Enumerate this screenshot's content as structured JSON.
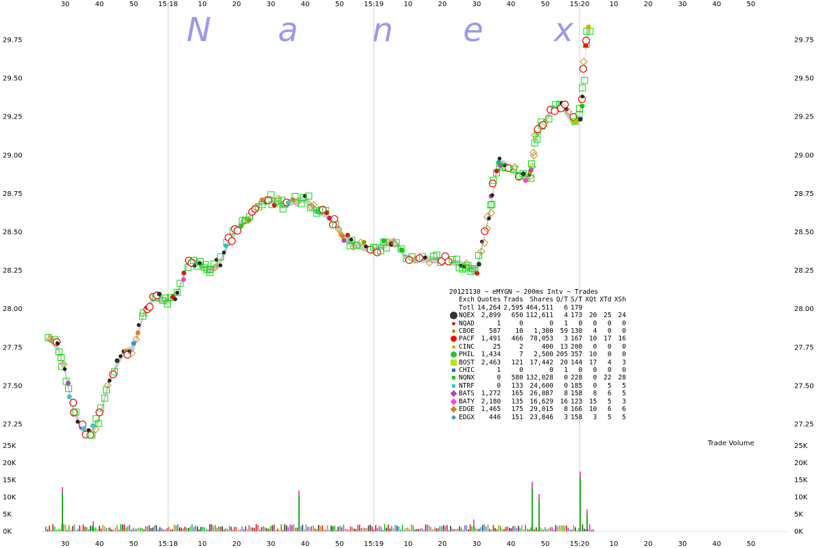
{
  "watermark": [
    "N",
    "a",
    "n",
    "e",
    "x"
  ],
  "legend_title": "20121130 ~ eMYGN ~ 200ms Intv ~ Trades",
  "legend_header": [
    "Exch",
    "Quotes",
    "Trads",
    "Shares",
    "Q/T",
    "S/T",
    "XQt",
    "XTd",
    "XSh"
  ],
  "legend_total": [
    "Totl",
    "14,264",
    "2,595",
    "464,511",
    "6",
    "179",
    "",
    "",
    ""
  ],
  "legend_rows": [
    {
      "exch": "NQEX",
      "quotes": "2,899",
      "trads": "650",
      "shares": "112,611",
      "qt": "4",
      "st": "173",
      "xqt": "20",
      "xtd": "25",
      "xsh": "24",
      "color": "#333333",
      "marker": "circle-large"
    },
    {
      "exch": "NQAD",
      "quotes": "1",
      "trads": "0",
      "shares": "0",
      "qt": "1",
      "st": "0",
      "xqt": "0",
      "xtd": "0",
      "xsh": "0",
      "color": "#cc2222",
      "marker": "circle-small"
    },
    {
      "exch": "CBOE",
      "quotes": "587",
      "trads": "10",
      "shares": "1,300",
      "qt": "59",
      "st": "130",
      "xqt": "4",
      "xtd": "0",
      "xsh": "0",
      "color": "#999900",
      "marker": "circle-small"
    },
    {
      "exch": "PACF",
      "quotes": "1,491",
      "trads": "466",
      "shares": "78,053",
      "qt": "3",
      "st": "167",
      "xqt": "10",
      "xtd": "17",
      "xsh": "16",
      "color": "#ff0000",
      "marker": "circle-medium"
    },
    {
      "exch": "CINC",
      "quotes": "25",
      "trads": "2",
      "shares": "400",
      "qt": "13",
      "st": "200",
      "xqt": "0",
      "xtd": "0",
      "xsh": "0",
      "color": "#ddaa00",
      "marker": "circle-small"
    },
    {
      "exch": "PHIL",
      "quotes": "1,434",
      "trads": "7",
      "shares": "2,500",
      "qt": "205",
      "st": "357",
      "xqt": "10",
      "xtd": "0",
      "xsh": "0",
      "color": "#33bb33",
      "marker": "circle-medium"
    },
    {
      "exch": "BOST",
      "quotes": "2,463",
      "trads": "121",
      "shares": "17,442",
      "qt": "20",
      "st": "144",
      "xqt": "17",
      "xtd": "4",
      "xsh": "3",
      "color": "#aaee00",
      "marker": "square-large"
    },
    {
      "exch": "CHIC",
      "quotes": "1",
      "trads": "0",
      "shares": "0",
      "qt": "1",
      "st": "0",
      "xqt": "0",
      "xtd": "0",
      "xsh": "0",
      "color": "#3366cc",
      "marker": "square-small"
    },
    {
      "exch": "NQNX",
      "quotes": "0",
      "trads": "580",
      "shares": "132,028",
      "qt": "0",
      "st": "228",
      "xqt": "0",
      "xtd": "22",
      "xsh": "28",
      "color": "#00cc00",
      "marker": "square-small"
    },
    {
      "exch": "NTRF",
      "quotes": "0",
      "trads": "133",
      "shares": "24,600",
      "qt": "0",
      "st": "185",
      "xqt": "0",
      "xtd": "5",
      "xsh": "5",
      "color": "#33cccc",
      "marker": "square-small"
    },
    {
      "exch": "BATS",
      "quotes": "1,272",
      "trads": "165",
      "shares": "26,087",
      "qt": "8",
      "st": "158",
      "xqt": "8",
      "xtd": "6",
      "xsh": "5",
      "color": "#aa44cc",
      "marker": "diamond"
    },
    {
      "exch": "BATY",
      "quotes": "2,180",
      "trads": "135",
      "shares": "16,629",
      "qt": "16",
      "st": "123",
      "xqt": "15",
      "xtd": "5",
      "xsh": "3",
      "color": "#ff44cc",
      "marker": "diamond"
    },
    {
      "exch": "EDGE",
      "quotes": "1,465",
      "trads": "175",
      "shares": "29,015",
      "qt": "8",
      "st": "166",
      "xqt": "10",
      "xtd": "6",
      "xsh": "6",
      "color": "#cc8822",
      "marker": "diamond"
    },
    {
      "exch": "EDGX",
      "quotes": "446",
      "trads": "151",
      "shares": "23,846",
      "qt": "3",
      "st": "158",
      "xqt": "3",
      "xtd": "5",
      "xsh": "5",
      "color": "#3399cc",
      "marker": "diamond-small"
    }
  ],
  "chart_data": {
    "type": "scatter",
    "title": "",
    "x_tick_labels": [
      "30",
      "40",
      "50",
      "15:18",
      "10",
      "20",
      "30",
      "40",
      "50",
      "15:19",
      "10",
      "20",
      "30",
      "40",
      "50",
      "15:20",
      "10",
      "20",
      "30",
      "40",
      "50"
    ],
    "x_range": [
      "15:17:25",
      "15:20:55"
    ],
    "y_price_ticks": [
      27.25,
      27.5,
      27.75,
      28.0,
      28.25,
      28.5,
      28.75,
      29.0,
      29.25,
      29.5,
      29.75
    ],
    "y_price_range": [
      27.13,
      29.89
    ],
    "volume_axis": {
      "title": "Trade Volume",
      "ticks": [
        "0K",
        "5K",
        "10K",
        "15K",
        "20K",
        "25K"
      ],
      "max": 25000
    },
    "price_path": [
      [
        "15:17:25",
        27.82
      ],
      [
        "15:17:28",
        27.75
      ],
      [
        "15:17:30",
        27.6
      ],
      [
        "15:17:32",
        27.38
      ],
      [
        "15:17:35",
        27.22
      ],
      [
        "15:17:38",
        27.2
      ],
      [
        "15:17:40",
        27.3
      ],
      [
        "15:17:43",
        27.55
      ],
      [
        "15:17:47",
        27.72
      ],
      [
        "15:17:50",
        27.75
      ],
      [
        "15:17:53",
        27.98
      ],
      [
        "15:17:56",
        28.08
      ],
      [
        "15:18:00",
        28.05
      ],
      [
        "15:18:03",
        28.12
      ],
      [
        "15:18:06",
        28.32
      ],
      [
        "15:18:09",
        28.3
      ],
      [
        "15:18:12",
        28.25
      ],
      [
        "15:18:15",
        28.3
      ],
      [
        "15:18:18",
        28.45
      ],
      [
        "15:18:21",
        28.55
      ],
      [
        "15:18:24",
        28.6
      ],
      [
        "15:18:27",
        28.7
      ],
      [
        "15:18:30",
        28.72
      ],
      [
        "15:18:33",
        28.68
      ],
      [
        "15:18:36",
        28.7
      ],
      [
        "15:18:40",
        28.72
      ],
      [
        "15:18:43",
        28.65
      ],
      [
        "15:18:46",
        28.62
      ],
      [
        "15:18:49",
        28.55
      ],
      [
        "15:18:52",
        28.45
      ],
      [
        "15:18:55",
        28.42
      ],
      [
        "15:19:00",
        28.38
      ],
      [
        "15:19:03",
        28.42
      ],
      [
        "15:19:06",
        28.45
      ],
      [
        "15:19:10",
        28.32
      ],
      [
        "15:19:15",
        28.33
      ],
      [
        "15:19:20",
        28.32
      ],
      [
        "15:19:25",
        28.3
      ],
      [
        "15:19:27",
        28.28
      ],
      [
        "15:19:30",
        28.26
      ],
      [
        "15:19:32",
        28.45
      ],
      [
        "15:19:34",
        28.65
      ],
      [
        "15:19:35",
        28.8
      ],
      [
        "15:19:36",
        28.95
      ],
      [
        "15:19:38",
        28.95
      ],
      [
        "15:19:42",
        28.88
      ],
      [
        "15:19:45",
        28.85
      ],
      [
        "15:19:46",
        28.9
      ],
      [
        "15:19:47",
        29.1
      ],
      [
        "15:19:49",
        29.2
      ],
      [
        "15:19:52",
        29.3
      ],
      [
        "15:19:55",
        29.32
      ],
      [
        "15:19:58",
        29.22
      ],
      [
        "15:20:00",
        29.25
      ],
      [
        "15:20:01",
        29.45
      ],
      [
        "15:20:02",
        29.75
      ],
      [
        "15:20:03",
        29.85
      ]
    ],
    "volume_spikes": [
      [
        "15:17:29",
        13000
      ],
      [
        "15:17:38",
        3000
      ],
      [
        "15:18:38",
        12000
      ],
      [
        "15:19:29",
        3500
      ],
      [
        "15:19:46",
        14500
      ],
      [
        "15:19:48",
        11000
      ],
      [
        "15:20:00",
        17500
      ],
      [
        "15:20:02",
        6500
      ]
    ]
  }
}
